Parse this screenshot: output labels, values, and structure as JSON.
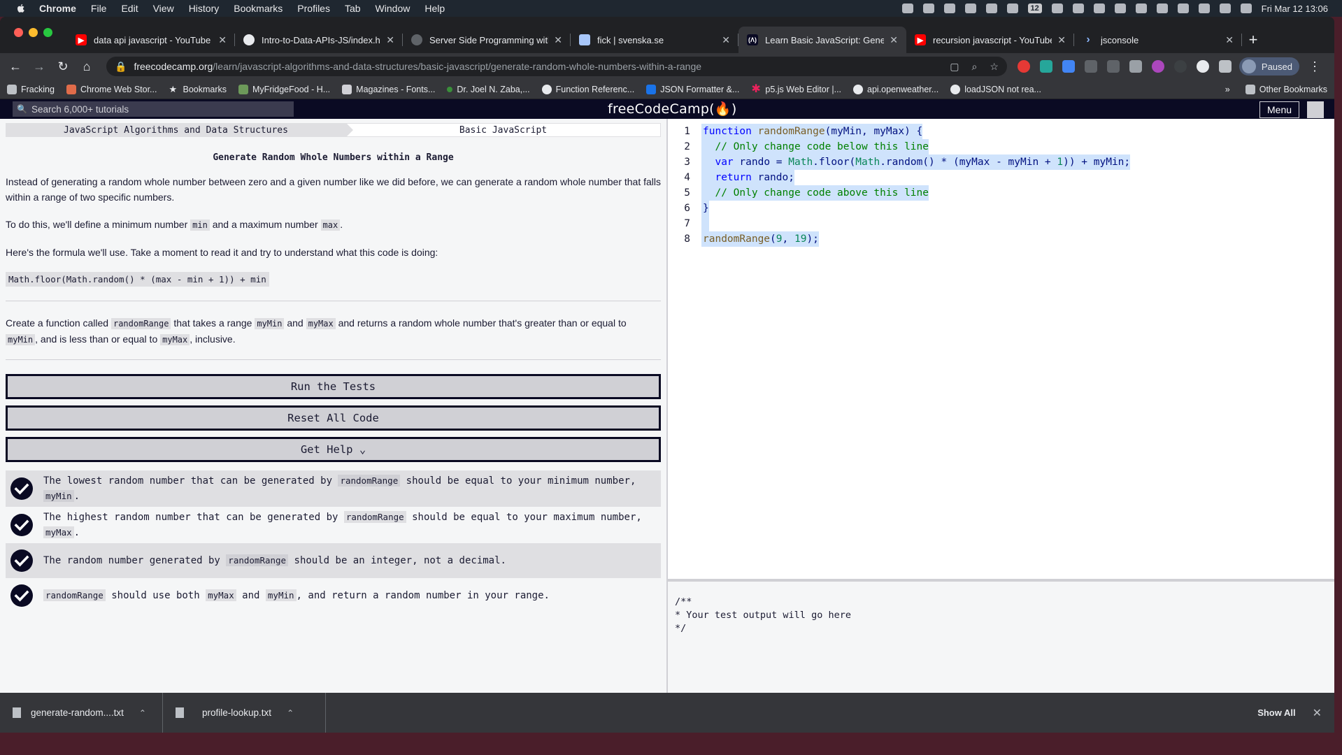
{
  "menubar": {
    "app": "Chrome",
    "items": [
      "File",
      "Edit",
      "View",
      "History",
      "Bookmarks",
      "Profiles",
      "Tab",
      "Window",
      "Help"
    ],
    "calendar_badge": "12",
    "clock": "Fri Mar 12  13:06"
  },
  "tabs": [
    {
      "title": "data api javascript - YouTube",
      "icon": "youtube-icon",
      "color": "#ff0000"
    },
    {
      "title": "Intro-to-Data-APIs-JS/index.ht",
      "icon": "github-icon",
      "color": "#e8eaed"
    },
    {
      "title": "Server Side Programming with",
      "icon": "globe-icon",
      "color": "#9aa0a6"
    },
    {
      "title": "fick | svenska.se",
      "icon": "page-icon",
      "color": "#a8c7fa"
    },
    {
      "title": "Learn Basic JavaScript: Genera",
      "icon": "freecodecamp-icon",
      "color": "#e8eaed"
    },
    {
      "title": "recursion javascript - YouTube",
      "icon": "youtube-icon",
      "color": "#ff0000"
    },
    {
      "title": "jsconsole",
      "icon": "terminal-icon",
      "color": "#8ab4f8"
    }
  ],
  "url": {
    "host": "freecodecamp.org",
    "path": "/learn/javascript-algorithms-and-data-structures/basic-javascript/generate-random-whole-numbers-within-a-range"
  },
  "profile_label": "Paused",
  "bookmarks": [
    {
      "label": "Fracking",
      "color": "#bdc1c6"
    },
    {
      "label": "Chrome Web Stor...",
      "color": "#e06c4a"
    },
    {
      "label": "Bookmarks",
      "color": "#e8eaed"
    },
    {
      "label": "MyFridgeFood - H...",
      "color": "#6d9a5a"
    },
    {
      "label": "Magazines - Fonts...",
      "color": "#d0d0d5"
    },
    {
      "label": "Dr. Joel N. Zaba,...",
      "color": "#3a8f3a"
    },
    {
      "label": "Function Referenc...",
      "color": "#e8eaed"
    },
    {
      "label": "JSON Formatter &...",
      "color": "#1a73e8"
    },
    {
      "label": "p5.js Web Editor |...",
      "color": "#ed225d"
    },
    {
      "label": "api.openweather...",
      "color": "#e8eaed"
    },
    {
      "label": "loadJSON not rea...",
      "color": "#e8eaed"
    }
  ],
  "other_bookmarks": "Other Bookmarks",
  "fcc": {
    "search_placeholder": "Search 6,000+ tutorials",
    "logo": "freeCodeCamp(🔥)",
    "menu": "Menu"
  },
  "challenge": {
    "breadcrumb_1": "JavaScript Algorithms and Data Structures",
    "breadcrumb_2": "Basic JavaScript",
    "title": "Generate Random Whole Numbers within a Range",
    "p1": "Instead of generating a random whole number between zero and a given number like we did before, we can generate a random whole number that falls within a range of two specific numbers.",
    "p2_pre": "To do this, we'll define a minimum number ",
    "p2_code1": "min",
    "p2_mid": " and a maximum number ",
    "p2_code2": "max",
    "p2_post": ".",
    "p3": "Here's the formula we'll use. Take a moment to read it and try to understand what this code is doing:",
    "formula": "Math.floor(Math.random() * (max - min + 1)) + min",
    "p4_a": "Create a function called ",
    "p4_c1": "randomRange",
    "p4_b": " that takes a range ",
    "p4_c2": "myMin",
    "p4_c": " and ",
    "p4_c3": "myMax",
    "p4_d": " and returns a random whole number that's greater than or equal to ",
    "p4_c4": "myMin",
    "p4_e": ", and is less than or equal to ",
    "p4_c5": "myMax",
    "p4_f": ", inclusive."
  },
  "buttons": {
    "run": "Run the Tests",
    "reset": "Reset All Code",
    "help": "Get Help ⌄"
  },
  "tests": [
    {
      "a": "The lowest random number that can be generated by ",
      "c1": "randomRange",
      "b": " should be equal to your minimum number, ",
      "c2": "myMin",
      "c": "."
    },
    {
      "a": "The highest random number that can be generated by ",
      "c1": "randomRange",
      "b": " should be equal to your maximum number, ",
      "c2": "myMax",
      "c": "."
    },
    {
      "a": "The random number generated by ",
      "c1": "randomRange",
      "b": " should be an integer, not a decimal."
    },
    {
      "c1": "randomRange",
      "b": " should use both ",
      "c2": "myMax",
      "c": " and ",
      "c3": "myMin",
      "d": ", and return a random number in your range."
    }
  ],
  "code_lines": [
    {
      "n": "1"
    },
    {
      "n": "2"
    },
    {
      "n": "3"
    },
    {
      "n": "4"
    },
    {
      "n": "5"
    },
    {
      "n": "6"
    },
    {
      "n": "7"
    },
    {
      "n": "8"
    }
  ],
  "code": {
    "l1_kw": "function",
    "l1_fn": "randomRange",
    "l1_rest": "(myMin, myMax) {",
    "l2": "  // Only change code below this line",
    "l3_kw": "var",
    "l3_a": " rando = ",
    "l3_m1": "Math",
    "l3_b": ".floor(",
    "l3_m2": "Math",
    "l3_c": ".random() * (myMax - myMin + ",
    "l3_n1": "1",
    "l3_d": ")) + myMin;",
    "l4_kw": "return",
    "l4_rest": " rando;",
    "l5": "  // Only change code above this line",
    "l6": "}",
    "l8_fn": "randomRange",
    "l8_a": "(",
    "l8_n1": "9",
    "l8_b": ", ",
    "l8_n2": "19",
    "l8_c": ");"
  },
  "output": {
    "l1": "/**",
    "l2": "* Your test output will go here",
    "l3": "*/"
  },
  "downloads": {
    "file1": "generate-random....txt",
    "file2": "profile-lookup.txt",
    "show_all": "Show All"
  }
}
